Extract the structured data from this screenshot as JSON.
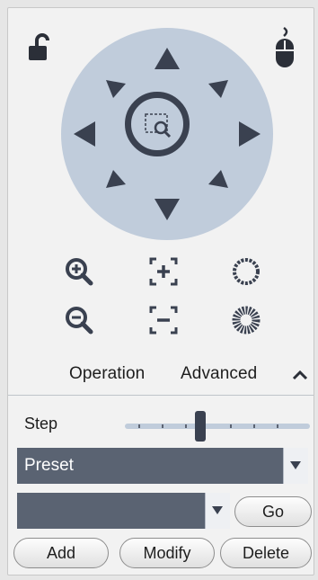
{
  "ptz": {
    "lock_icon": "unlock-icon",
    "mouse_icon": "mouse-icon",
    "center_icon": "zoom-area-icon",
    "directions": [
      "up",
      "up-right",
      "right",
      "down-right",
      "down",
      "down-left",
      "left",
      "up-left"
    ]
  },
  "controls": {
    "zoom_in_icon": "zoom-in-icon",
    "zoom_out_icon": "zoom-out-icon",
    "focus_near_icon": "focus-near-icon",
    "focus_far_icon": "focus-far-icon",
    "iris_open_icon": "iris-open-icon",
    "iris_close_icon": "iris-close-icon"
  },
  "tabs": {
    "operation": "Operation",
    "advanced": "Advanced",
    "collapse_icon": "chevron-up-icon"
  },
  "step": {
    "label": "Step",
    "value_fraction": 0.4
  },
  "preset": {
    "selected": "Preset",
    "number_value": "",
    "go_label": "Go"
  },
  "buttons": {
    "add": "Add",
    "modify": "Modify",
    "delete": "Delete"
  },
  "colors": {
    "disc": "#c0ccdb",
    "arrow": "#3a4150",
    "select_bg": "#5a6372"
  }
}
